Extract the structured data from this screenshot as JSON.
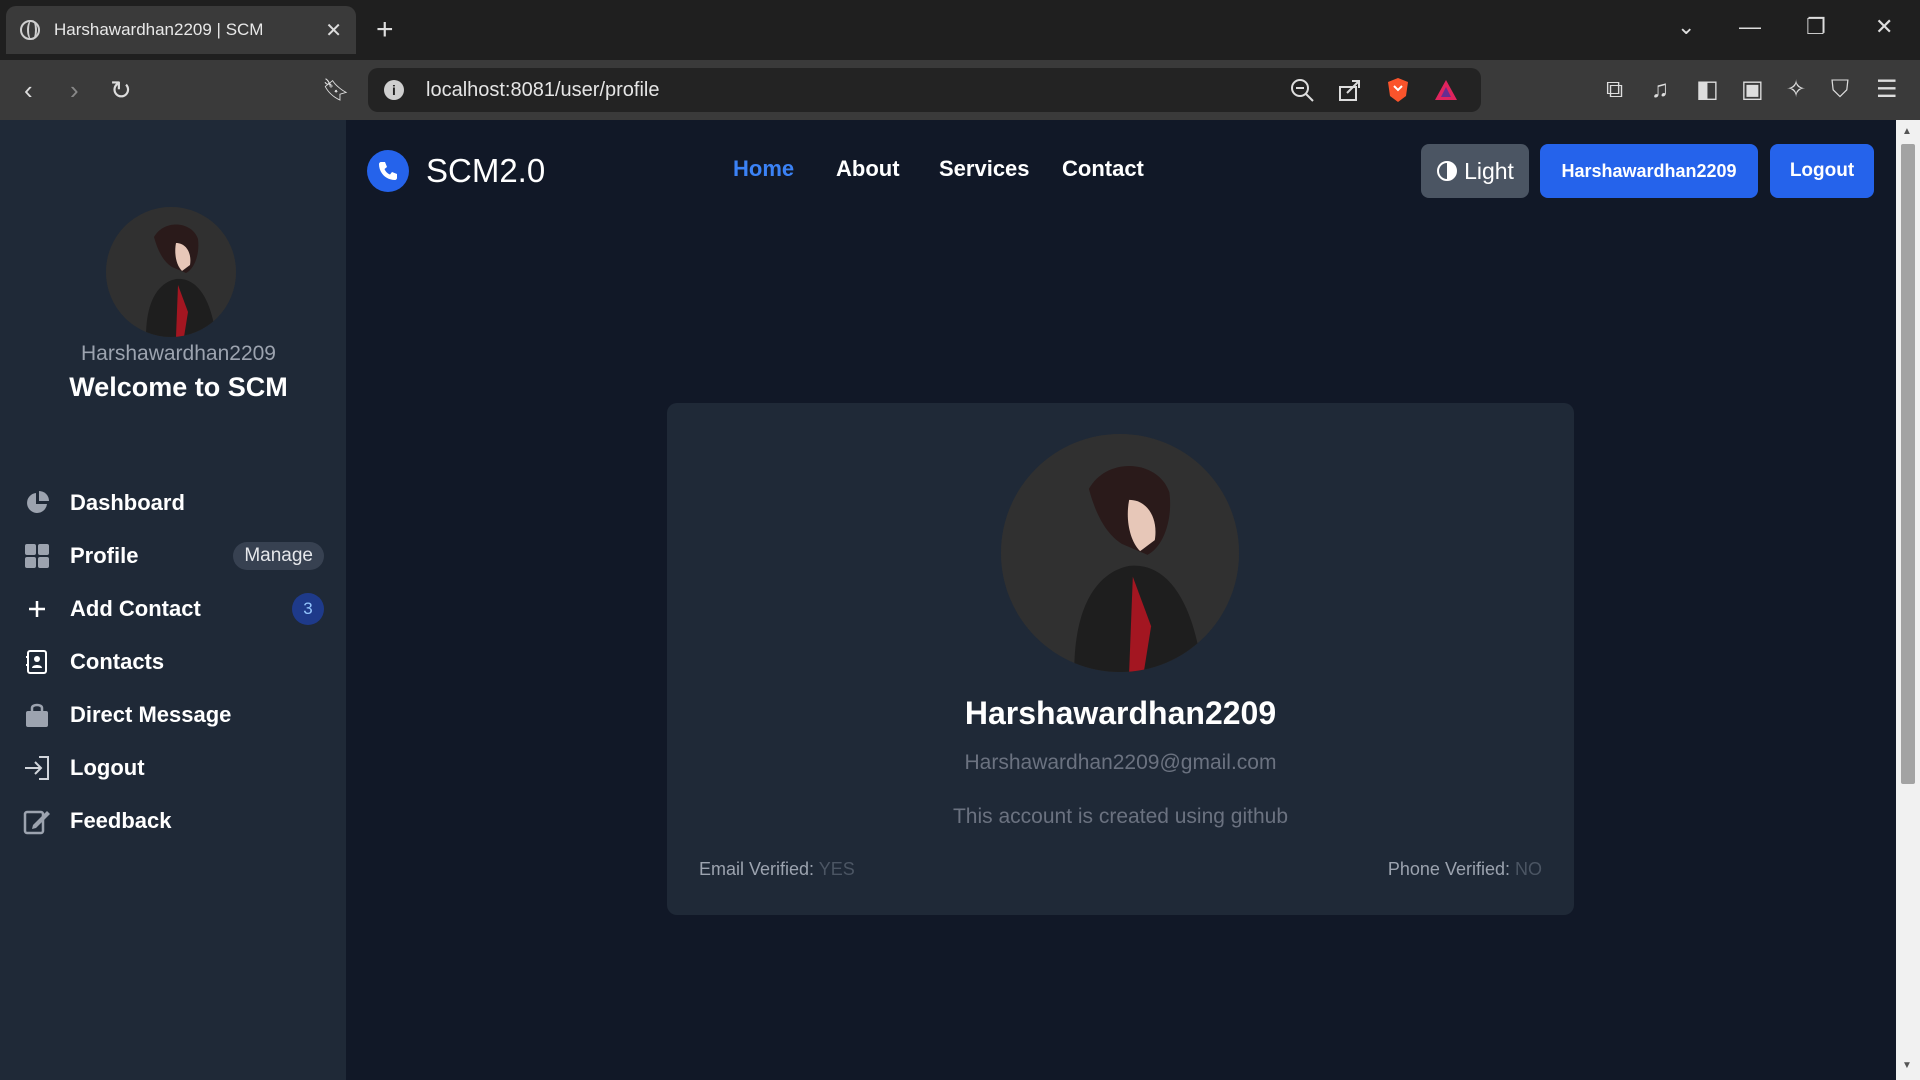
{
  "browser": {
    "tab_title": "Harshawardhan2209 | SCM",
    "tab_close": "✕",
    "new_tab": "+",
    "url": "localhost:8081/user/profile"
  },
  "sidebar": {
    "username": "Harshawardhan2209",
    "welcome": "Welcome to SCM",
    "items": [
      {
        "label": "Dashboard"
      },
      {
        "label": "Profile",
        "badge": "Manage"
      },
      {
        "label": "Add Contact",
        "badge": "3"
      },
      {
        "label": "Contacts"
      },
      {
        "label": "Direct Message"
      },
      {
        "label": "Logout"
      },
      {
        "label": "Feedback"
      }
    ]
  },
  "navbar": {
    "brand": "SCM2.0",
    "links": [
      "Home",
      "About",
      "Services",
      "Contact"
    ],
    "theme_button": "Light",
    "user_button": "Harshawardhan2209",
    "logout_button": "Logout"
  },
  "profile": {
    "name": "Harshawardhan2209",
    "email": "Harshawardhan2209@gmail.com",
    "description": "This account is created using github",
    "email_verified_label": "Email Verified:",
    "email_verified_value": "YES",
    "phone_verified_label": "Phone Verified:",
    "phone_verified_value": "NO"
  },
  "colors": {
    "accent": "#2563eb",
    "background": "#111827",
    "panel": "#1f2937"
  }
}
